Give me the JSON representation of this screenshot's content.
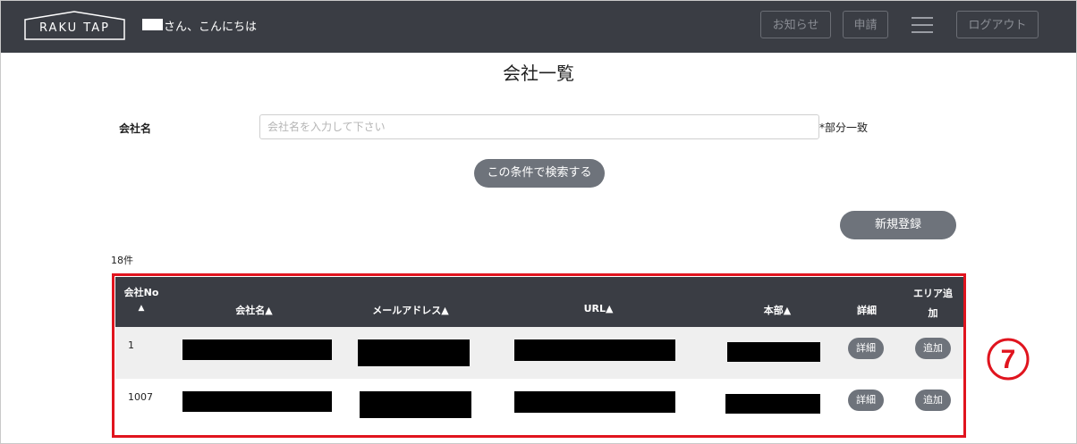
{
  "header": {
    "logo_text": "RAKU TAP",
    "greeting": "さん、こんにちは",
    "notices_label": "お知らせ",
    "apply_label": "申請",
    "logout_label": "ログアウト"
  },
  "page": {
    "title": "会社一覧"
  },
  "search": {
    "label": "会社名",
    "placeholder": "会社名を入力して下さい",
    "value": "",
    "note": "*部分一致",
    "submit_label": "この条件で検索する"
  },
  "actions": {
    "new_label": "新規登録"
  },
  "results": {
    "count": "18件"
  },
  "table": {
    "headers": {
      "no_line1": "会社No",
      "no_line2": "▲",
      "name": "会社名▲",
      "email": "メールアドレス▲",
      "url": "URL▲",
      "hq": "本部▲",
      "detail": "詳細",
      "area_line1": "エリア追",
      "area_line2": "加"
    },
    "rows": [
      {
        "no": "1",
        "detail_label": "詳細",
        "add_label": "追加"
      },
      {
        "no": "1007",
        "detail_label": "詳細",
        "add_label": "追加"
      }
    ]
  },
  "annotation": {
    "marker": "7",
    "color": "#e0141e"
  },
  "colors": {
    "header_bg": "#3a3d44",
    "button_bg": "#6e737b"
  }
}
